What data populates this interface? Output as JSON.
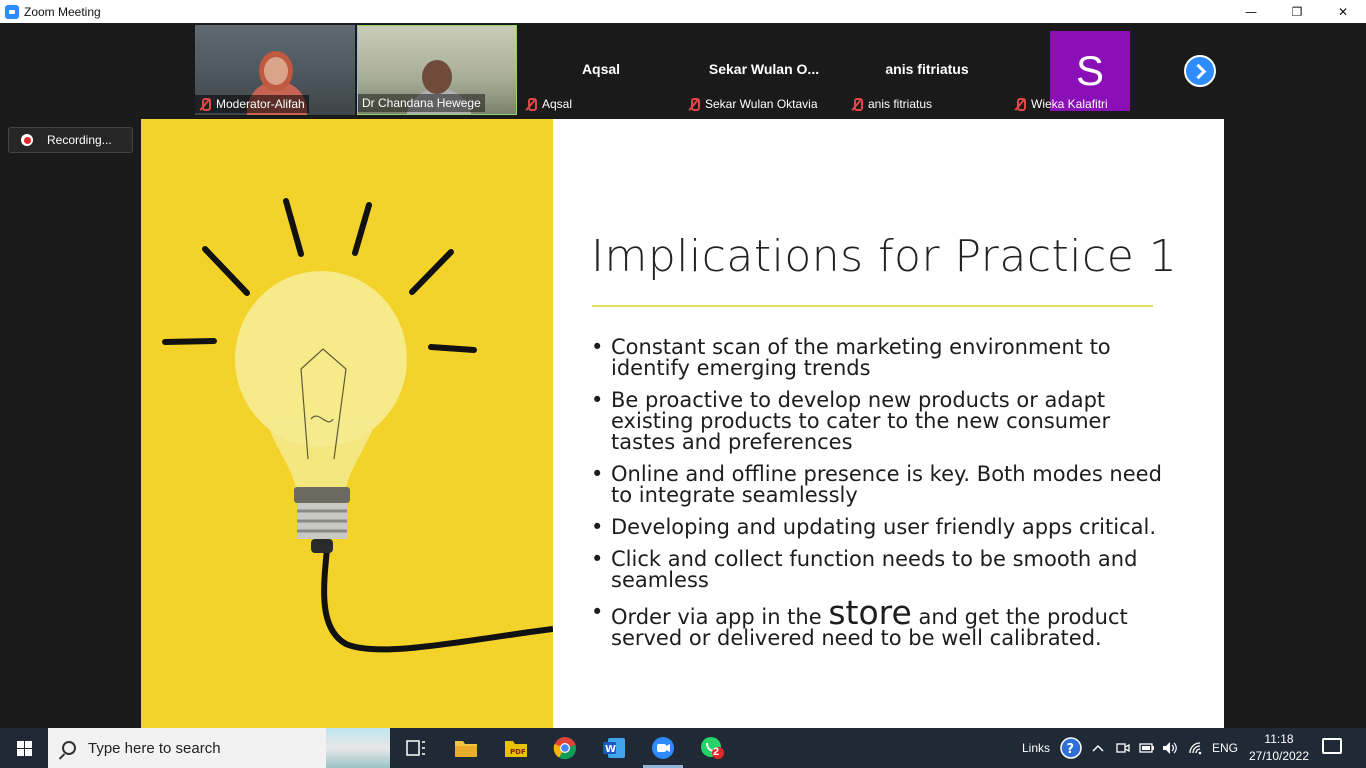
{
  "window": {
    "title": "Zoom Meeting",
    "controls": [
      "—",
      "❐",
      "✕"
    ]
  },
  "participants": [
    {
      "name": "Moderator-Alifah",
      "type": "video"
    },
    {
      "name": "Dr Chandana Hewege",
      "type": "video"
    },
    {
      "name": "Aqsal",
      "display_name": "Aqsal",
      "type": "name"
    },
    {
      "name": "Sekar Wulan  Oktavia",
      "display_name": "Sekar  Wulan   O...",
      "type": "name"
    },
    {
      "name": "anis fitriatus",
      "display_name": "anis fitriatus",
      "type": "name"
    },
    {
      "name": "Wieka Kalafitri",
      "avatar_letter": "S",
      "avatar_color": "#8a0fb7",
      "type": "avatar"
    }
  ],
  "recording": {
    "label": "Recording..."
  },
  "slide": {
    "title": "Implications for Practice 1",
    "bullets": [
      "Constant scan of the marketing environment to identify emerging trends",
      "Be proactive to develop new products or adapt existing products to cater to the new consumer tastes and preferences",
      "Online and offline presence is key. Both modes need to integrate seamlessly",
      "Developing and updating user friendly apps critical.",
      "Click and collect function needs to be smooth and seamless"
    ],
    "last_bullet": {
      "before": "Order via app in the ",
      "big": "store",
      "after": " and get the product served  or delivered need to be well calibrated."
    },
    "accent_yellow": "#f3d329"
  },
  "taskbar": {
    "search_placeholder": "Type here to search",
    "apps": [
      "task-view",
      "file-explorer",
      "pdf-reader",
      "chrome",
      "word",
      "zoom",
      "whatsapp"
    ],
    "whatsapp_badge": "2",
    "links_label": "Links",
    "language": "ENG",
    "time": "11:18",
    "date": "27/10/2022"
  }
}
